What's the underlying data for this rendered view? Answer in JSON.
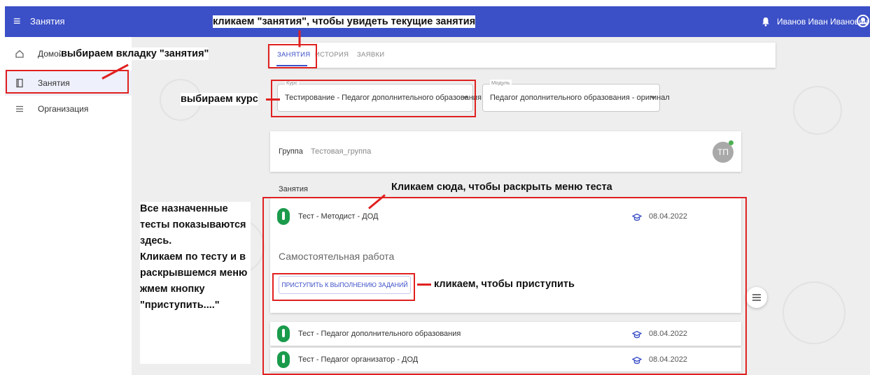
{
  "header": {
    "menu_icon": "menu-icon",
    "title": "Занятия",
    "user_name": "Иванов Иван Иванович"
  },
  "sidebar": {
    "items": [
      {
        "label": "Домой",
        "icon": "home-icon"
      },
      {
        "label": "Занятия",
        "icon": "book-icon"
      },
      {
        "label": "Организация",
        "icon": "list-icon"
      }
    ]
  },
  "tabs": [
    "ЗАНЯТИЯ",
    "ИСТОРИЯ",
    "ЗАЯВКИ"
  ],
  "filters": {
    "course_label": "Курс",
    "course_value": "Тестирование - Педагог дополнительного образования",
    "module_label": "Модуль",
    "module_value": "Педагог дополнительного образования - оригинал"
  },
  "group": {
    "label": "Группа",
    "value": "Тестовая_группа",
    "avatar": "ТП"
  },
  "lessons": {
    "section_title": "Занятия",
    "expanded": {
      "name": "Тест - Методист - ДОД",
      "date": "08.04.2022",
      "subtitle": "Самостоятельная работа",
      "button": "ПРИСТУПИТЬ К ВЫПОЛНЕНИЮ ЗАДАНИЙ"
    },
    "items": [
      {
        "name": "Тест - Педагог дополнительного образования",
        "date": "08.04.2022"
      },
      {
        "name": "Тест - Педагог организатор - ДОД",
        "date": "08.04.2022"
      }
    ]
  },
  "annotations": {
    "top": "кликаем \"занятия\", чтобы увидеть текущие занятия",
    "sidebar": "выбираем вкладку \"занятия\"",
    "course": "выбираем курс",
    "expand": "Кликаем сюда, чтобы раскрыть меню теста",
    "start": "кликаем, чтобы приступить",
    "left_lines": [
      "Все назначенные",
      "тесты показываются",
      "здесь.",
      "Кликаем по тесту и в",
      "раскрывшемся меню",
      "жмем кнопку",
      "\"приступить....\""
    ]
  },
  "colors": {
    "primary": "#3b4fc7",
    "annotation": "#e02020",
    "test_icon": "#1a9b4b"
  }
}
